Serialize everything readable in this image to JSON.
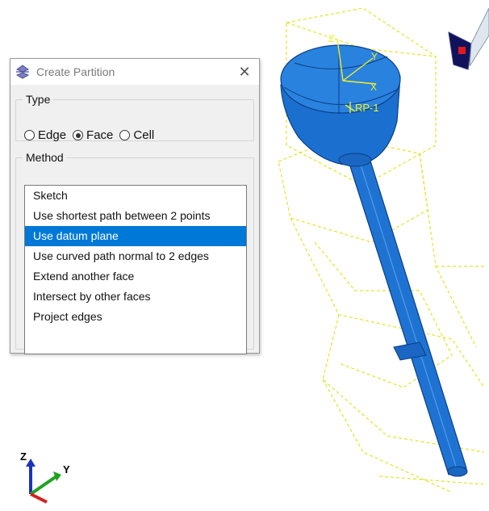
{
  "dialog": {
    "title": "Create Partition",
    "close_icon": "close-icon",
    "type_group": {
      "legend": "Type",
      "options": [
        "Edge",
        "Face",
        "Cell"
      ],
      "selected": "Face"
    },
    "method_group": {
      "legend": "Method",
      "items": [
        "Sketch",
        "Use shortest path between 2 points",
        "Use datum plane",
        "Use curved path normal to 2 edges",
        "Extend another face",
        "Intersect by other faces",
        "Project edges"
      ],
      "selected": "Use datum plane"
    }
  },
  "viewport": {
    "reference_point_label": "RP-1",
    "datum_axis_labels": [
      "Z",
      "Y",
      "X"
    ],
    "triad_labels": [
      "Z",
      "Y"
    ],
    "colors": {
      "part": "#1e73d2",
      "datum": "#e6e61e",
      "selection": "#0078d7"
    }
  }
}
